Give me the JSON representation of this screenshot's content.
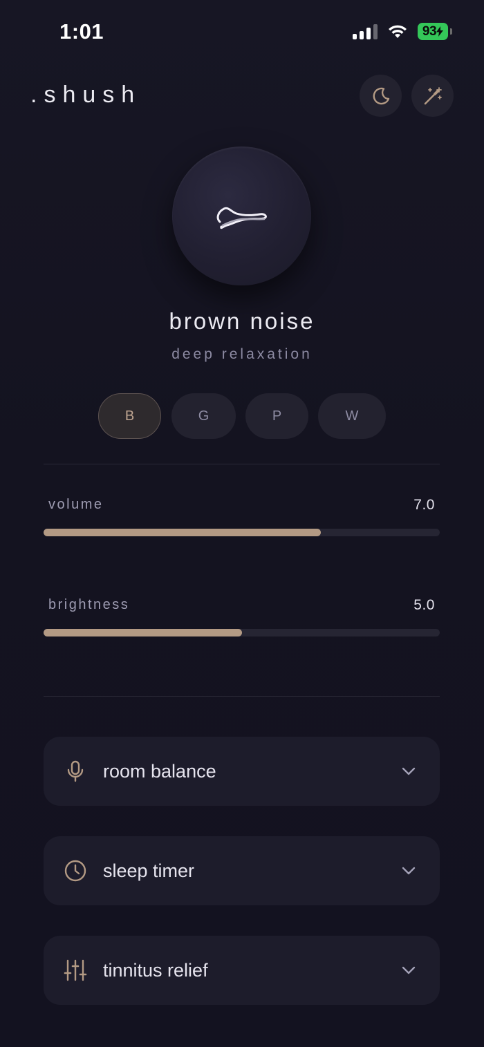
{
  "status_bar": {
    "time": "1:01",
    "battery": "93"
  },
  "header": {
    "brand": ".shush",
    "moon_icon": "moon-icon",
    "wand_icon": "magic-wand-icon"
  },
  "noise": {
    "icon": "squiggle-wave-icon",
    "title": "brown noise",
    "subtitle": "deep relaxation",
    "types": [
      {
        "label": "B",
        "active": true
      },
      {
        "label": "G",
        "active": false
      },
      {
        "label": "P",
        "active": false
      },
      {
        "label": "W",
        "active": false
      }
    ]
  },
  "sliders": {
    "volume": {
      "label": "volume",
      "value": "7.0",
      "fraction": 0.7
    },
    "brightness": {
      "label": "brightness",
      "value": "5.0",
      "fraction": 0.5
    }
  },
  "sections": [
    {
      "label": "room balance",
      "icon": "microphone-icon"
    },
    {
      "label": "sleep timer",
      "icon": "clock-icon"
    },
    {
      "label": "tinnitus relief",
      "icon": "sliders-icon"
    }
  ],
  "colors": {
    "accent": "#b39a84",
    "background": "#131220",
    "card": "#1d1c2b"
  }
}
